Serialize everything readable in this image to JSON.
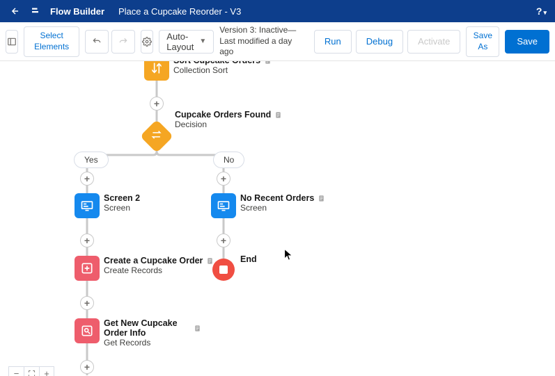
{
  "header": {
    "app_name": "Flow Builder",
    "flow_name": "Place a Cupcake Reorder - V3",
    "help": "?"
  },
  "toolbar": {
    "select_elements_1": "Select",
    "select_elements_2": "Elements",
    "layout_mode": "Auto-Layout",
    "version_text": "Version 3: Inactive—Last modified a day ago",
    "run": "Run",
    "debug": "Debug",
    "activate": "Activate",
    "save_as": "Save As",
    "save": "Save"
  },
  "nodes": {
    "sort": {
      "title": "Sort Cupcake Orders",
      "subtitle": "Collection Sort",
      "color": "#f5a623"
    },
    "decision": {
      "title": "Cupcake Orders Found",
      "subtitle": "Decision",
      "color": "#f5a623"
    },
    "screen2": {
      "title": "Screen 2",
      "subtitle": "Screen",
      "color": "#1589ee"
    },
    "norecent": {
      "title": "No Recent Orders",
      "subtitle": "Screen",
      "color": "#1589ee"
    },
    "create": {
      "title": "Create a Cupcake Order",
      "subtitle": "Create Records",
      "color": "#ee5d6c"
    },
    "getnew": {
      "title": "Get New Cupcake Order Info",
      "subtitle": "Get Records",
      "color": "#ee5d6c"
    },
    "end": {
      "title": "End"
    }
  },
  "branches": {
    "yes": "Yes",
    "no": "No"
  },
  "colors": {
    "header": "#0d3e8c",
    "primary": "#0070d2",
    "connector": "#c9c9c9"
  }
}
